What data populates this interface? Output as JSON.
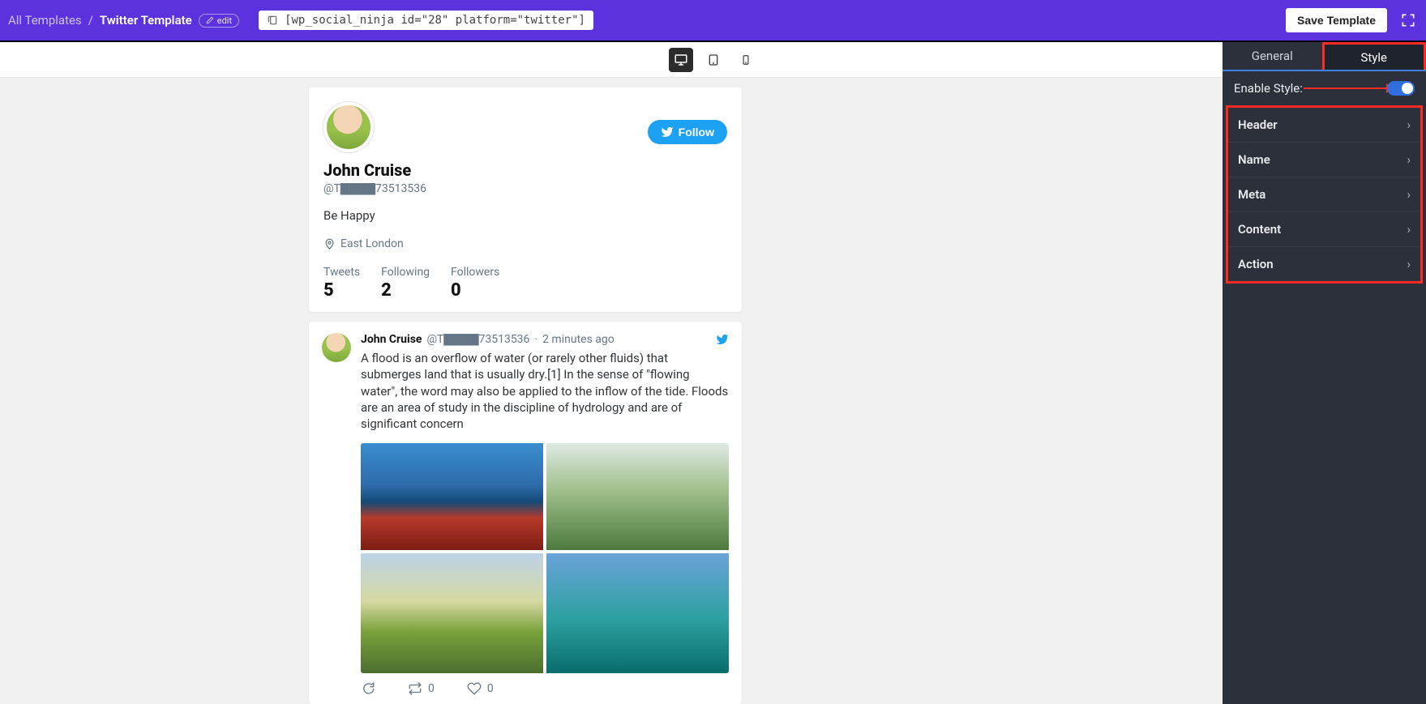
{
  "topbar": {
    "breadcrumb_root": "All Templates",
    "breadcrumb_current": "Twitter Template",
    "edit_label": "edit",
    "shortcode": "[wp_social_ninja id=\"28\" platform=\"twitter\"]",
    "save_label": "Save Template"
  },
  "sidebar": {
    "tab_general": "General",
    "tab_style": "Style",
    "enable_style_label": "Enable Style:",
    "items": [
      {
        "label": "Header"
      },
      {
        "label": "Name"
      },
      {
        "label": "Meta"
      },
      {
        "label": "Content"
      },
      {
        "label": "Action"
      }
    ]
  },
  "profile": {
    "name": "John Cruise",
    "handle": "@T▇▇▇▇73513536",
    "bio": "Be Happy",
    "location": "East London",
    "follow_label": "Follow",
    "stats": {
      "tweets_label": "Tweets",
      "tweets_val": "5",
      "following_label": "Following",
      "following_val": "2",
      "followers_label": "Followers",
      "followers_val": "0"
    }
  },
  "tweet": {
    "name": "John Cruise",
    "handle": "@T▇▇▇▇73513536",
    "time": "2 minutes ago",
    "text": "A flood is an overflow of water (or rarely other fluids) that submerges land that is usually dry.[1] In the sense of \"flowing water\", the word may also be applied to the inflow of the tide. Floods are an area of study in the discipline of hydrology and are of significant concern",
    "retweets": "0",
    "likes": "0"
  }
}
